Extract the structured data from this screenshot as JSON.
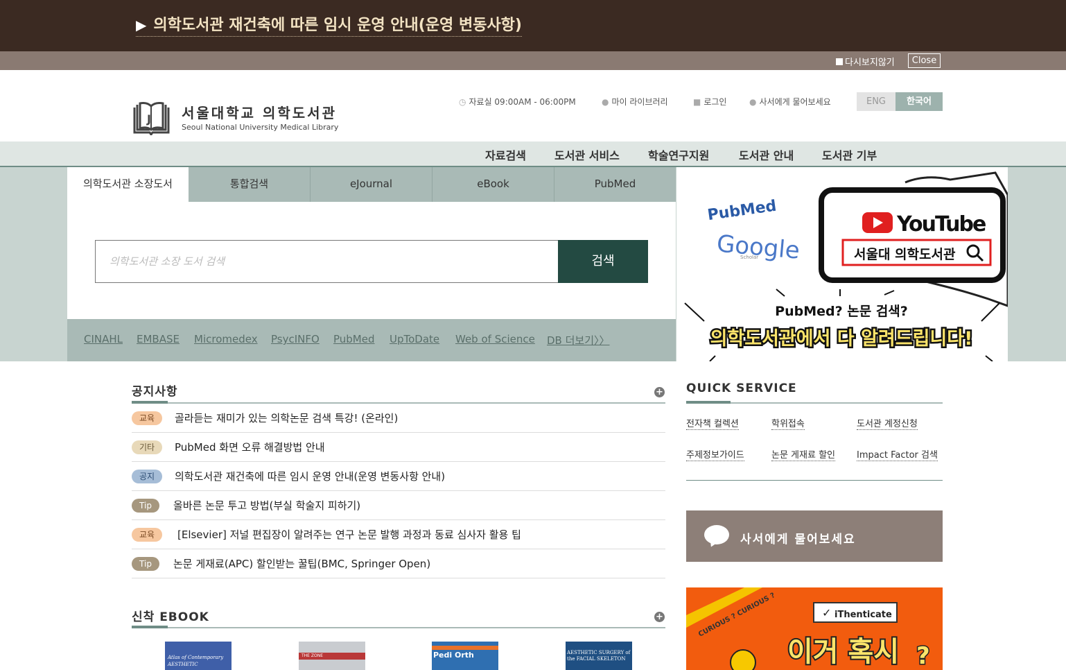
{
  "notice_banner": {
    "text": "의학도서관 재건축에 따른 임시 운영 안내(운영 변동사항)",
    "dont_show_label": "다시보지않기",
    "close_label": "Close"
  },
  "header": {
    "logo_ko": "서울대학교 의학도서관",
    "logo_en": "Seoul National University Medical Library",
    "hours": "자료실 09:00AM - 06:00PM",
    "my_library": "마이 라이브러리",
    "login": "로그인",
    "ask_librarian": "사서에게 물어보세요",
    "lang_eng": "ENG",
    "lang_ko": "한국어"
  },
  "gnb": [
    "자료검색",
    "도서관 서비스",
    "학술연구지원",
    "도서관 안내",
    "도서관 기부"
  ],
  "search": {
    "tabs": [
      "의학도서관 소장도서",
      "통합검색",
      "eJournal",
      "eBook",
      "PubMed"
    ],
    "placeholder": "의학도서관 소장 도서 검색",
    "button": "검색",
    "db_links": [
      "CINAHL",
      "EMBASE",
      "Micromedex",
      "PsycINFO",
      "PubMed",
      "UpToDate",
      "Web of Science",
      "DB 더보기〉〉"
    ]
  },
  "banner": {
    "pubmed": "PubMed",
    "google": "Google",
    "scholar": "Scholar",
    "youtube": "YouTube",
    "search_text": "서울대 의학도서관",
    "question": "PubMed? 논문 검색?",
    "headline": "의학도서관에서 다 알려드립니다!"
  },
  "notices": {
    "title": "공지사항",
    "items": [
      {
        "badge": "교육",
        "text": "골라듣는 재미가 있는 의학논문 검색 특강! (온라인)"
      },
      {
        "badge": "기타",
        "text": "PubMed 화면 오류 해결방법 안내"
      },
      {
        "badge": "공지",
        "text": "의학도서관 재건축에 따른 임시 운영 안내(운영 변동사항 안내)"
      },
      {
        "badge": "Tip",
        "text": "올바른 논문 투고 방법(부실 학술지 피하기)"
      },
      {
        "badge": "교육",
        "text": "[Elsevier] 저널 편집장이 알려주는 연구 논문 발행 과정과 동료 심사자 활용 팁"
      },
      {
        "badge": "Tip",
        "text": "논문 게재료(APC) 할인받는 꿀팁(BMC, Springer Open)"
      }
    ]
  },
  "quick_service": {
    "title": "QUICK SERVICE",
    "links": [
      "전자책 컬렉션",
      "학위접속",
      "도서관 계정신청",
      "주제정보가이드",
      "논문 게재료 할인",
      "Impact Factor 검색"
    ]
  },
  "ask_box": "사서에게 물어보세요",
  "ithenticate": {
    "logo": "iThenticate",
    "headline": "이거 혹시",
    "tape": "CURIOUS ? CURIOUS ?"
  },
  "ebook": {
    "title": "신착 EBOOK",
    "covers": [
      {
        "text": "Atlas of Contemporary AESTHETIC",
        "color": "#3f5fa8"
      },
      {
        "text": "THE ZONE",
        "color": "#c9ccd0"
      },
      {
        "text": "Pedi Orth",
        "color": "#2f6fb1"
      },
      {
        "text": "AESTHETIC SURGERY of the FACIAL SKELETON",
        "color": "#1f4f82"
      }
    ]
  }
}
